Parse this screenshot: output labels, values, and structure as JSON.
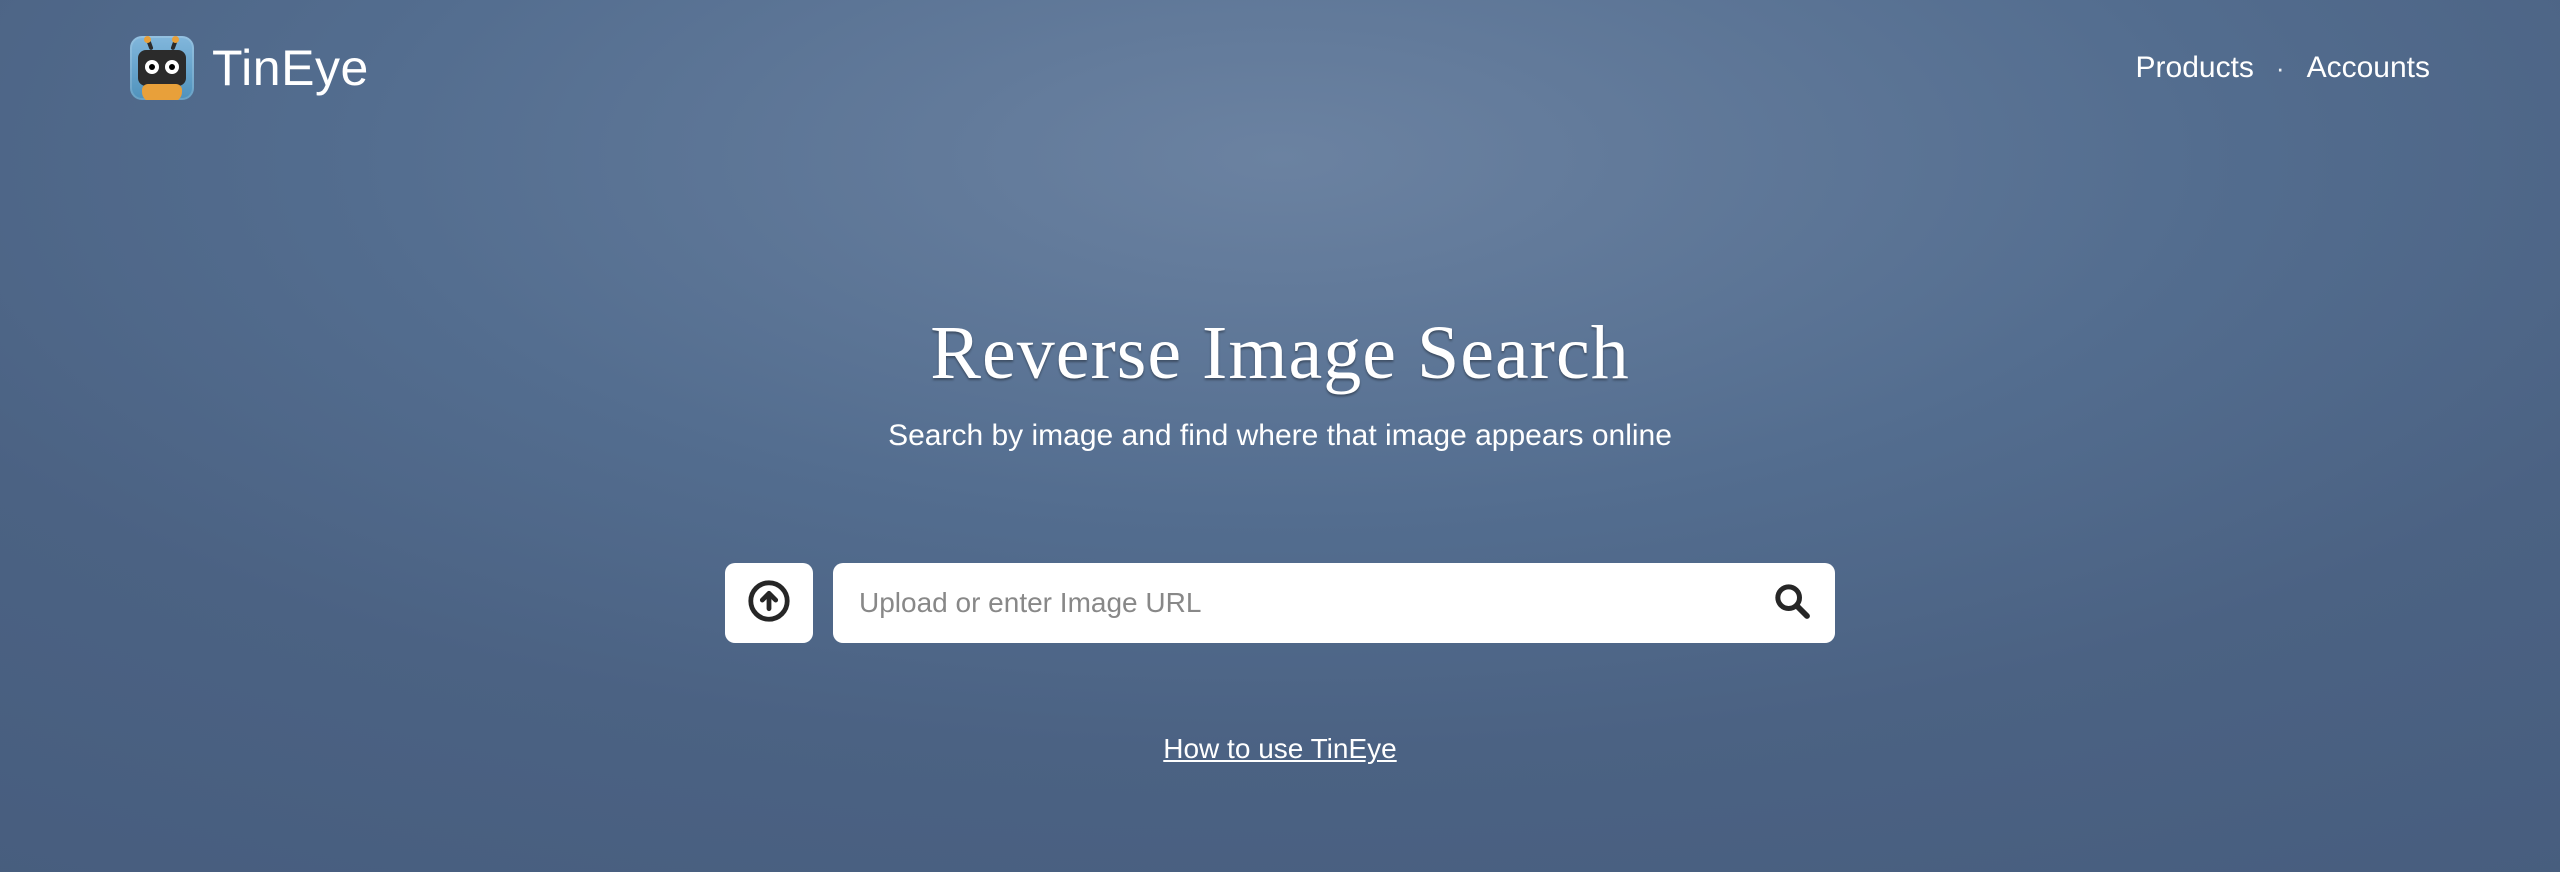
{
  "brand": {
    "name": "TinEye"
  },
  "nav": {
    "products": "Products",
    "accounts": "Accounts",
    "separator": "·"
  },
  "hero": {
    "title": "Reverse Image Search",
    "subtitle": "Search by image and find where that image appears online"
  },
  "search": {
    "placeholder": "Upload or enter Image URL",
    "value": ""
  },
  "help": {
    "label": "How to use TinEye"
  },
  "icons": {
    "logo": "tineye-robot-icon",
    "upload": "upload-arrow-circle-icon",
    "search": "magnifier-icon"
  }
}
